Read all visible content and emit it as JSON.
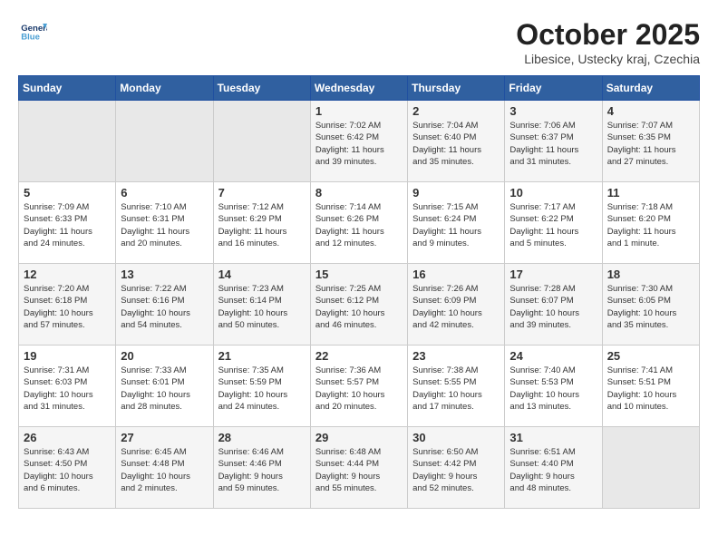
{
  "header": {
    "logo_line1": "General",
    "logo_line2": "Blue",
    "month": "October 2025",
    "location": "Libesice, Ustecky kraj, Czechia"
  },
  "weekdays": [
    "Sunday",
    "Monday",
    "Tuesday",
    "Wednesday",
    "Thursday",
    "Friday",
    "Saturday"
  ],
  "weeks": [
    [
      {
        "day": "",
        "info": ""
      },
      {
        "day": "",
        "info": ""
      },
      {
        "day": "",
        "info": ""
      },
      {
        "day": "1",
        "info": "Sunrise: 7:02 AM\nSunset: 6:42 PM\nDaylight: 11 hours\nand 39 minutes."
      },
      {
        "day": "2",
        "info": "Sunrise: 7:04 AM\nSunset: 6:40 PM\nDaylight: 11 hours\nand 35 minutes."
      },
      {
        "day": "3",
        "info": "Sunrise: 7:06 AM\nSunset: 6:37 PM\nDaylight: 11 hours\nand 31 minutes."
      },
      {
        "day": "4",
        "info": "Sunrise: 7:07 AM\nSunset: 6:35 PM\nDaylight: 11 hours\nand 27 minutes."
      }
    ],
    [
      {
        "day": "5",
        "info": "Sunrise: 7:09 AM\nSunset: 6:33 PM\nDaylight: 11 hours\nand 24 minutes."
      },
      {
        "day": "6",
        "info": "Sunrise: 7:10 AM\nSunset: 6:31 PM\nDaylight: 11 hours\nand 20 minutes."
      },
      {
        "day": "7",
        "info": "Sunrise: 7:12 AM\nSunset: 6:29 PM\nDaylight: 11 hours\nand 16 minutes."
      },
      {
        "day": "8",
        "info": "Sunrise: 7:14 AM\nSunset: 6:26 PM\nDaylight: 11 hours\nand 12 minutes."
      },
      {
        "day": "9",
        "info": "Sunrise: 7:15 AM\nSunset: 6:24 PM\nDaylight: 11 hours\nand 9 minutes."
      },
      {
        "day": "10",
        "info": "Sunrise: 7:17 AM\nSunset: 6:22 PM\nDaylight: 11 hours\nand 5 minutes."
      },
      {
        "day": "11",
        "info": "Sunrise: 7:18 AM\nSunset: 6:20 PM\nDaylight: 11 hours\nand 1 minute."
      }
    ],
    [
      {
        "day": "12",
        "info": "Sunrise: 7:20 AM\nSunset: 6:18 PM\nDaylight: 10 hours\nand 57 minutes."
      },
      {
        "day": "13",
        "info": "Sunrise: 7:22 AM\nSunset: 6:16 PM\nDaylight: 10 hours\nand 54 minutes."
      },
      {
        "day": "14",
        "info": "Sunrise: 7:23 AM\nSunset: 6:14 PM\nDaylight: 10 hours\nand 50 minutes."
      },
      {
        "day": "15",
        "info": "Sunrise: 7:25 AM\nSunset: 6:12 PM\nDaylight: 10 hours\nand 46 minutes."
      },
      {
        "day": "16",
        "info": "Sunrise: 7:26 AM\nSunset: 6:09 PM\nDaylight: 10 hours\nand 42 minutes."
      },
      {
        "day": "17",
        "info": "Sunrise: 7:28 AM\nSunset: 6:07 PM\nDaylight: 10 hours\nand 39 minutes."
      },
      {
        "day": "18",
        "info": "Sunrise: 7:30 AM\nSunset: 6:05 PM\nDaylight: 10 hours\nand 35 minutes."
      }
    ],
    [
      {
        "day": "19",
        "info": "Sunrise: 7:31 AM\nSunset: 6:03 PM\nDaylight: 10 hours\nand 31 minutes."
      },
      {
        "day": "20",
        "info": "Sunrise: 7:33 AM\nSunset: 6:01 PM\nDaylight: 10 hours\nand 28 minutes."
      },
      {
        "day": "21",
        "info": "Sunrise: 7:35 AM\nSunset: 5:59 PM\nDaylight: 10 hours\nand 24 minutes."
      },
      {
        "day": "22",
        "info": "Sunrise: 7:36 AM\nSunset: 5:57 PM\nDaylight: 10 hours\nand 20 minutes."
      },
      {
        "day": "23",
        "info": "Sunrise: 7:38 AM\nSunset: 5:55 PM\nDaylight: 10 hours\nand 17 minutes."
      },
      {
        "day": "24",
        "info": "Sunrise: 7:40 AM\nSunset: 5:53 PM\nDaylight: 10 hours\nand 13 minutes."
      },
      {
        "day": "25",
        "info": "Sunrise: 7:41 AM\nSunset: 5:51 PM\nDaylight: 10 hours\nand 10 minutes."
      }
    ],
    [
      {
        "day": "26",
        "info": "Sunrise: 6:43 AM\nSunset: 4:50 PM\nDaylight: 10 hours\nand 6 minutes."
      },
      {
        "day": "27",
        "info": "Sunrise: 6:45 AM\nSunset: 4:48 PM\nDaylight: 10 hours\nand 2 minutes."
      },
      {
        "day": "28",
        "info": "Sunrise: 6:46 AM\nSunset: 4:46 PM\nDaylight: 9 hours\nand 59 minutes."
      },
      {
        "day": "29",
        "info": "Sunrise: 6:48 AM\nSunset: 4:44 PM\nDaylight: 9 hours\nand 55 minutes."
      },
      {
        "day": "30",
        "info": "Sunrise: 6:50 AM\nSunset: 4:42 PM\nDaylight: 9 hours\nand 52 minutes."
      },
      {
        "day": "31",
        "info": "Sunrise: 6:51 AM\nSunset: 4:40 PM\nDaylight: 9 hours\nand 48 minutes."
      },
      {
        "day": "",
        "info": ""
      }
    ]
  ]
}
